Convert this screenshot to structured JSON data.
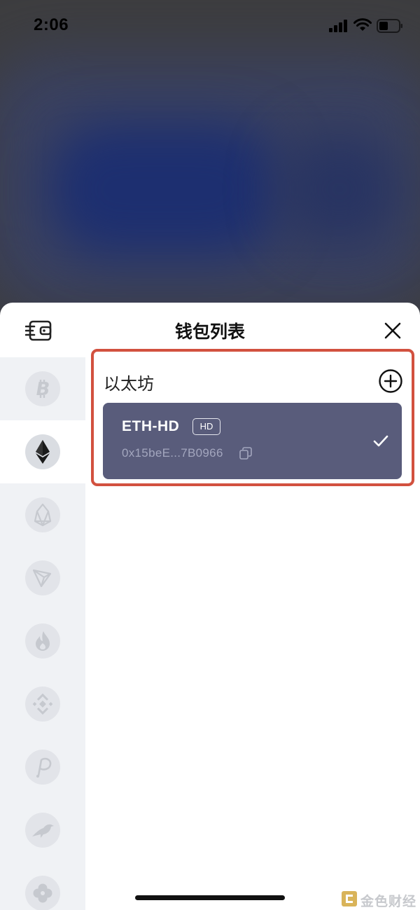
{
  "status_bar": {
    "time": "2:06"
  },
  "sheet": {
    "title": "钱包列表"
  },
  "chains": [
    {
      "name": "bitcoin",
      "icon": "bitcoin-icon",
      "active": false
    },
    {
      "name": "ethereum",
      "icon": "ethereum-icon",
      "active": true
    },
    {
      "name": "eos",
      "icon": "eos-icon",
      "active": false
    },
    {
      "name": "tron",
      "icon": "tron-icon",
      "active": false
    },
    {
      "name": "heco",
      "icon": "flame-icon",
      "active": false
    },
    {
      "name": "binance",
      "icon": "binance-icon",
      "active": false
    },
    {
      "name": "polkadot",
      "icon": "polkadot-icon",
      "active": false
    },
    {
      "name": "kusama",
      "icon": "bird-icon",
      "active": false
    },
    {
      "name": "more",
      "icon": "flower-icon",
      "active": false
    }
  ],
  "section": {
    "title": "以太坊"
  },
  "wallet": {
    "name": "ETH-HD",
    "badge": "HD",
    "address": "0x15beE...7B0966",
    "selected": true
  },
  "watermark": {
    "text": "金色财经"
  },
  "colors": {
    "card_bg": "#595c7b",
    "highlight_border": "#d2513f",
    "sidebar_bg": "#f0f2f5"
  }
}
